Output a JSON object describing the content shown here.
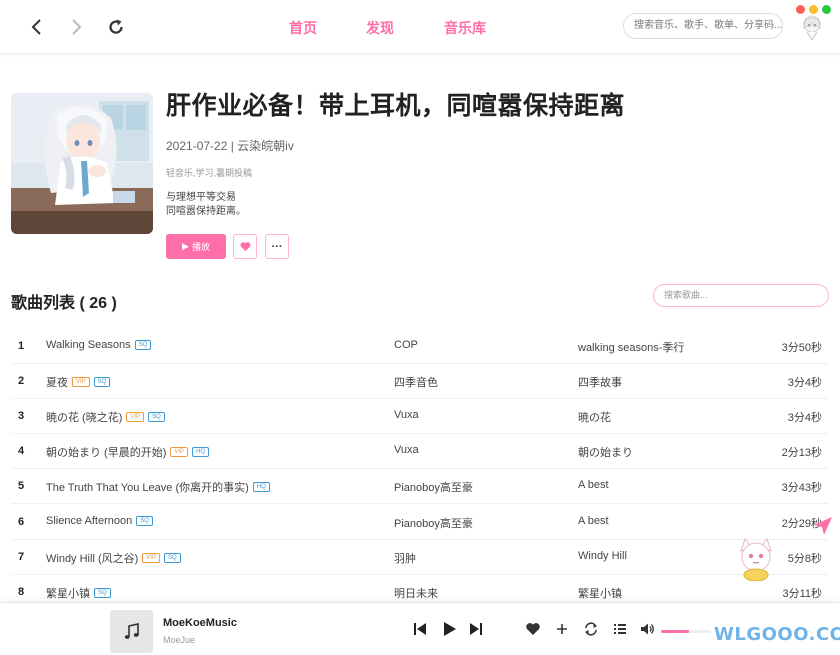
{
  "topbar": {
    "tabs": [
      "首页",
      "发现",
      "音乐库"
    ],
    "search_placeholder": "搜索音乐、歌手、歌单、分享码..."
  },
  "window_dots": [
    "#ff5f57",
    "#febc2e",
    "#28c840"
  ],
  "playlist": {
    "title": "肝作业必备！带上耳机，同喧嚣保持距离",
    "meta": "2021-07-22 | 云染皖朝iv",
    "tags": "轻音乐,学习,暑期投稿",
    "desc_line1": "与理想平等交易",
    "desc_line2": "同喧嚣保持距离。",
    "play_label": "播放"
  },
  "songlist": {
    "title": "歌曲列表 ( 26 )",
    "search_placeholder": "搜索歌曲...",
    "rows": [
      {
        "idx": "1",
        "name": "Walking Seasons",
        "badges": [
          "SQ"
        ],
        "artist": "COP",
        "album": "walking seasons-季行",
        "dur": "3分50秒"
      },
      {
        "idx": "2",
        "name": "夏夜",
        "badges": [
          "VIP",
          "SQ"
        ],
        "artist": "四季音色",
        "album": "四季故事",
        "dur": "3分4秒"
      },
      {
        "idx": "3",
        "name": "暁の花 (晓之花)",
        "badges": [
          "VIP",
          "SQ"
        ],
        "artist": "Vuxa",
        "album": "暁の花",
        "dur": "3分4秒"
      },
      {
        "idx": "4",
        "name": "朝の始まり (早晨的开始)",
        "badges": [
          "VIP",
          "HQ"
        ],
        "artist": "Vuxa",
        "album": "朝の始まり",
        "dur": "2分13秒"
      },
      {
        "idx": "5",
        "name": "The Truth That You Leave (你离开的事实)",
        "badges": [
          "HQ"
        ],
        "artist": "Pianoboy高至豪",
        "album": "A best",
        "dur": "3分43秒"
      },
      {
        "idx": "6",
        "name": "Slience Afternoon",
        "badges": [
          "SQ"
        ],
        "artist": "Pianoboy高至豪",
        "album": "A best",
        "dur": "2分29秒"
      },
      {
        "idx": "7",
        "name": "Windy Hill (风之谷)",
        "badges": [
          "VIP",
          "SQ"
        ],
        "artist": "羽肿",
        "album": "Windy Hill",
        "dur": "5分8秒"
      },
      {
        "idx": "8",
        "name": "繁星小镇",
        "badges": [
          "SQ"
        ],
        "artist": "明日未来",
        "album": "繁星小镇",
        "dur": "3分11秒"
      }
    ]
  },
  "player": {
    "title": "MoeKoeMusic",
    "artist": "MoeJue",
    "volume_fraction": 0.55
  },
  "watermark": "WLGOOO.COM",
  "colors": {
    "accent": "#ff6ea9"
  }
}
